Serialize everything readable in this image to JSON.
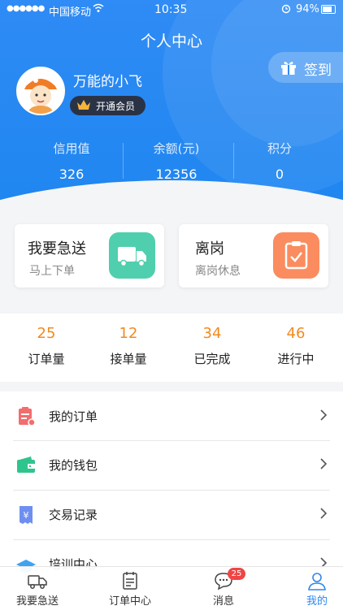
{
  "status_bar": {
    "signal": "●●●●●●",
    "carrier": "中国移动",
    "time": "10:35",
    "battery": "94%",
    "battery_level": 0.94
  },
  "header": {
    "title": "个人中心",
    "signin_label": "签到",
    "username": "万能的小飞",
    "vip_label": "开通会员",
    "stats": [
      {
        "label": "信用值",
        "value": "326"
      },
      {
        "label": "余额(元)",
        "value": "12356"
      },
      {
        "label": "积分",
        "value": "0"
      }
    ]
  },
  "cards": [
    {
      "title": "我要急送",
      "subtitle": "马上下单",
      "icon": "truck-icon",
      "color": "#4fcfae"
    },
    {
      "title": "离岗",
      "subtitle": "离岗休息",
      "icon": "clipboard-check-icon",
      "color": "#fb8c5f"
    }
  ],
  "counts": [
    {
      "value": "25",
      "label": "订单量"
    },
    {
      "value": "12",
      "label": "接单量"
    },
    {
      "value": "34",
      "label": "已完成"
    },
    {
      "value": "46",
      "label": "进行中"
    }
  ],
  "menu": [
    {
      "label": "我的订单",
      "icon": "order-doc-icon",
      "color": "#f26d6d"
    },
    {
      "label": "我的钱包",
      "icon": "wallet-icon",
      "color": "#2fc48e"
    },
    {
      "label": "交易记录",
      "icon": "transaction-yen-icon",
      "color": "#6f8ff0"
    },
    {
      "label": "培训中心",
      "icon": "graduation-cap-icon",
      "color": "#3fa3ef"
    }
  ],
  "tabbar": {
    "items": [
      {
        "label": "我要急送",
        "icon": "truck-outline-icon"
      },
      {
        "label": "订单中心",
        "icon": "calendar-list-icon"
      },
      {
        "label": "消息",
        "icon": "chat-bubble-icon",
        "badge": "25"
      },
      {
        "label": "我的",
        "icon": "person-icon",
        "active": true
      }
    ]
  },
  "colors": {
    "primary": "#2f87ef",
    "accent_orange": "#f28a1e",
    "badge_red": "#f04545"
  }
}
